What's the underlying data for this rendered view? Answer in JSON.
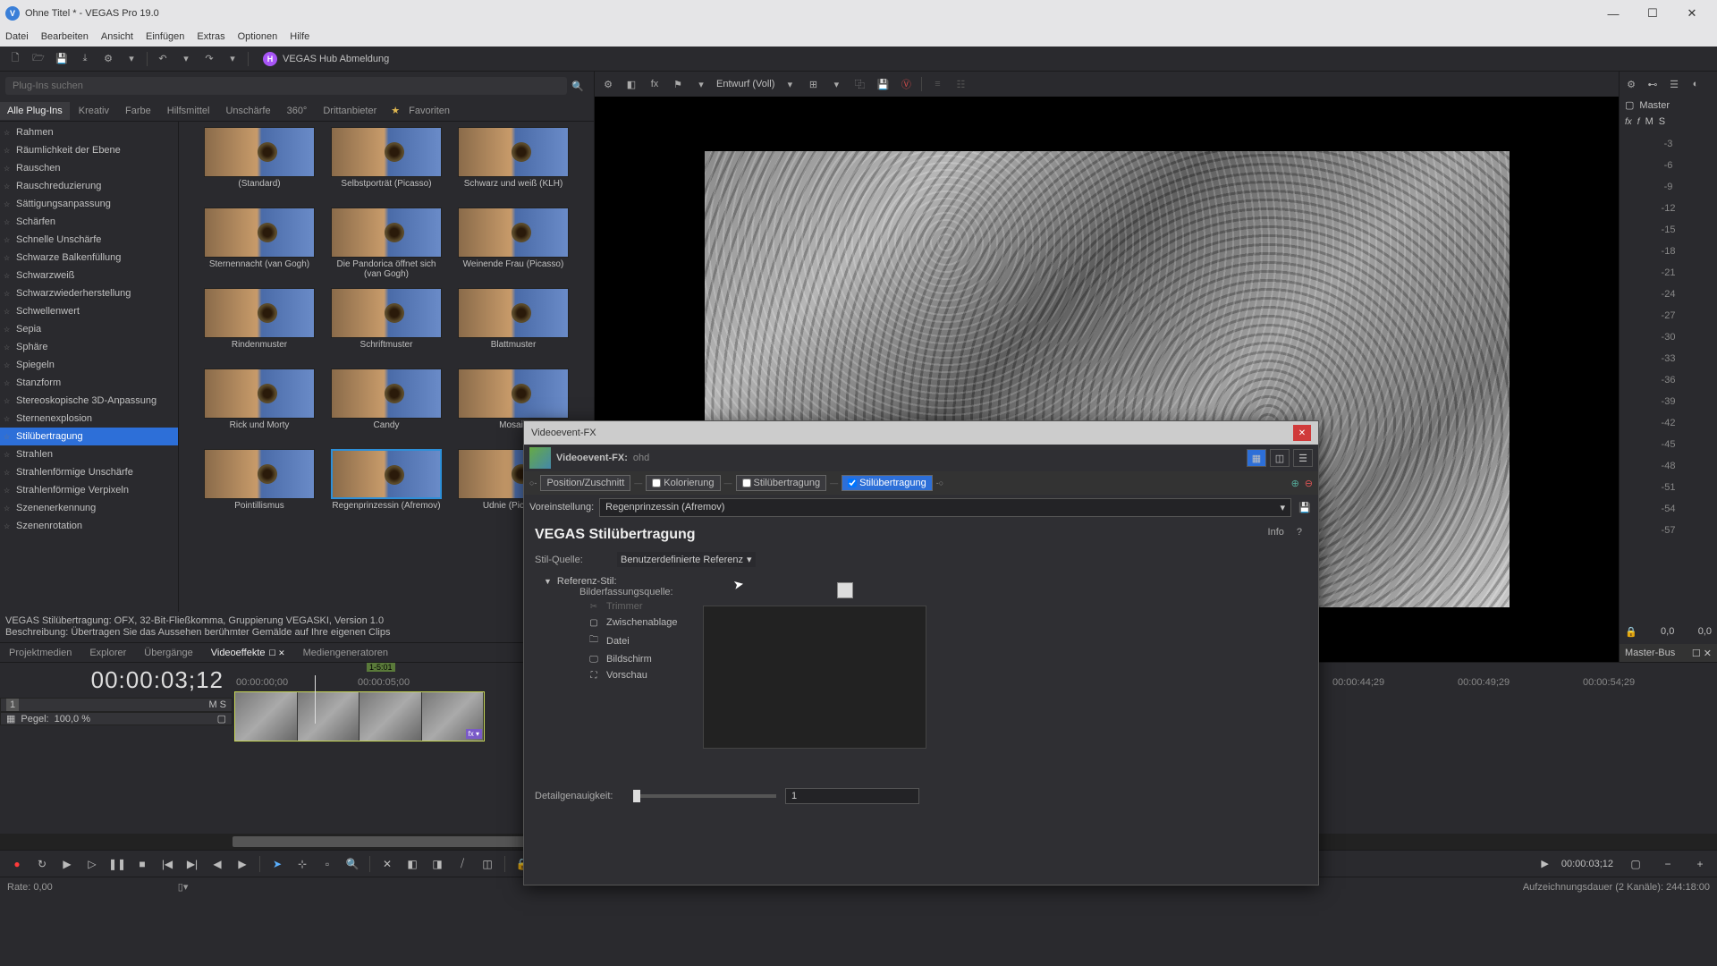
{
  "window": {
    "title": "Ohne Titel * - VEGAS Pro 19.0"
  },
  "menu": [
    "Datei",
    "Bearbeiten",
    "Ansicht",
    "Einfügen",
    "Extras",
    "Optionen",
    "Hilfe"
  ],
  "hub": {
    "label": "VEGAS Hub Abmeldung",
    "badge": "H"
  },
  "search": {
    "placeholder": "Plug-Ins suchen"
  },
  "categoryTabs": [
    "Alle Plug-Ins",
    "Kreativ",
    "Farbe",
    "Hilfsmittel",
    "Unschärfe",
    "360°",
    "Drittanbieter"
  ],
  "favoritesLabel": "Favoriten",
  "fxList": [
    "Rahmen",
    "Räumlichkeit der Ebene",
    "Rauschen",
    "Rauschreduzierung",
    "Sättigungsanpassung",
    "Schärfen",
    "Schnelle Unschärfe",
    "Schwarze Balkenfüllung",
    "Schwarzweiß",
    "Schwarzwiederherstellung",
    "Schwellenwert",
    "Sepia",
    "Sphäre",
    "Spiegeln",
    "Stanzform",
    "Stereoskopische 3D-Anpassung",
    "Sternenexplosion",
    "Stilübertragung",
    "Strahlen",
    "Strahlenförmige Unschärfe",
    "Strahlenförmige Verpixeln",
    "Szenenerkennung",
    "Szenenrotation"
  ],
  "fxListSelected": "Stilübertragung",
  "presets": [
    {
      "label": "(Standard)"
    },
    {
      "label": "Selbstporträt (Picasso)"
    },
    {
      "label": "Schwarz und weiß (KLH)"
    },
    {
      "label": "Sternennacht (van Gogh)"
    },
    {
      "label": "Die Pandorica öffnet sich (van Gogh)"
    },
    {
      "label": "Weinende Frau (Picasso)"
    },
    {
      "label": "Rindenmuster"
    },
    {
      "label": "Schriftmuster"
    },
    {
      "label": "Blattmuster"
    },
    {
      "label": "Rick und Morty"
    },
    {
      "label": "Candy"
    },
    {
      "label": "Mosaik"
    },
    {
      "label": "Pointillismus"
    },
    {
      "label": "Regenprinzessin (Afremov)",
      "selected": true
    },
    {
      "label": "Udnie (Picabia)"
    }
  ],
  "desc": {
    "line1": "VEGAS Stilübertragung: OFX, 32-Bit-Fließkomma, Gruppierung VEGASKI, Version 1.0",
    "line2": "Beschreibung: Übertragen Sie das Aussehen berühmter Gemälde auf Ihre eigenen Clips"
  },
  "bottomTabs": [
    "Projektmedien",
    "Explorer",
    "Übergänge",
    "Videoeffekte",
    "Mediengeneratoren"
  ],
  "bottomTabActive": "Videoeffekte",
  "previewToolbar": {
    "quality": "Entwurf (Voll)"
  },
  "meter": {
    "masterLabel": "Master",
    "fxLabels": [
      "fx",
      "f",
      "M",
      "S"
    ],
    "db": [
      "-3",
      "-6",
      "-9",
      "-12",
      "-15",
      "-18",
      "-21",
      "-24",
      "-27",
      "-30",
      "-33",
      "-36",
      "-39",
      "-42",
      "-45",
      "-48",
      "-51",
      "-54",
      "-57"
    ],
    "footLeft": "0,0",
    "footRight": "0,0",
    "busTab": "Master-Bus"
  },
  "timeline": {
    "timecode": "00:00:03;12",
    "track": {
      "num": "1",
      "name": "Pegel:",
      "level": "100,0 %",
      "ms": "M   S"
    },
    "marker": "1-5:01",
    "rulerMarks": [
      "00:00:00;00",
      "00:00:05;00",
      "00:00:44;29",
      "00:00:49;29",
      "00:00:54;29"
    ],
    "clipName": "ohd",
    "clipFx": "fx ▾"
  },
  "transport": {
    "rightTimecode": "00:00:03;12",
    "tcIcon": "▶"
  },
  "status": {
    "rate": "Rate: 0,00",
    "right": "Aufzeichnungsdauer (2 Kanäle): 244:18:00"
  },
  "dialog": {
    "title": "Videoevent-FX",
    "fxName": "Videoevent-FX:",
    "fxFile": "ohd",
    "chain": [
      {
        "label": "Position/Zuschnitt",
        "checked": false
      },
      {
        "label": "Kolorierung",
        "checked": false
      },
      {
        "label": "Stilübertragung",
        "checked": false
      },
      {
        "label": "Stilübertragung",
        "checked": true,
        "active": true
      }
    ],
    "presetLabel": "Voreinstellung:",
    "presetValue": "Regenprinzessin (Afremov)",
    "heading": "VEGAS Stilübertragung",
    "infoLabel": "Info",
    "helpLabel": "?",
    "styleSourceLabel": "Stil-Quelle:",
    "styleSourceValue": "Benutzerdefinierte Referenz",
    "refStyleLabel": "Referenz-Stil:",
    "captureLabel": "Bilderfassungsquelle:",
    "captureItems": [
      {
        "icon": "✂",
        "label": "Trimmer",
        "disabled": true
      },
      {
        "icon": "▢",
        "label": "Zwischenablage"
      },
      {
        "icon": "🗀",
        "label": "Datei"
      },
      {
        "icon": "🖵",
        "label": "Bildschirm"
      },
      {
        "icon": "⛶",
        "label": "Vorschau"
      }
    ],
    "detailLabel": "Detailgenauigkeit:",
    "detailValue": "1"
  }
}
